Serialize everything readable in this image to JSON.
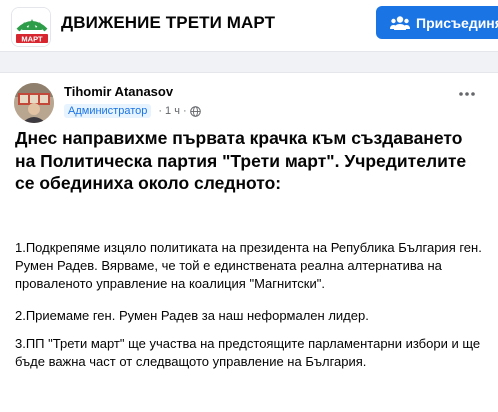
{
  "group": {
    "name": "ДВИЖЕНИЕ ТРЕТИ МАРТ",
    "logo_text": "МАРТ",
    "join_label": "Присъединя"
  },
  "post": {
    "author": "Tihomir Atanasov",
    "role": "Администратор",
    "time": "1 ч",
    "headline": "Днес направихме първата крачка към създаването на Политическа партия \"Трети март\". Учредителите се обединиха около следното:",
    "paragraphs": [
      "1.Подкрепяме изцяло политиката на президента на Република България ген. Румен Радев. Вярваме, че той е единствената реална алтернатива на провaленото управление на коалиция \"Магнитски\".",
      "2.Приемаме ген. Румен Радев за наш неформален лидер.",
      "3.ПП \"Трети март\" ще участва на предстоящите парламентарни избори и ще бъде важна част от следващото управление на България."
    ]
  },
  "icons": {
    "join": "group-join-icon",
    "privacy": "globe-icon",
    "more": "more-options-icon"
  },
  "colors": {
    "accent": "#1b74e4",
    "logo_green": "#2e9d49",
    "logo_red": "#d7262f"
  }
}
